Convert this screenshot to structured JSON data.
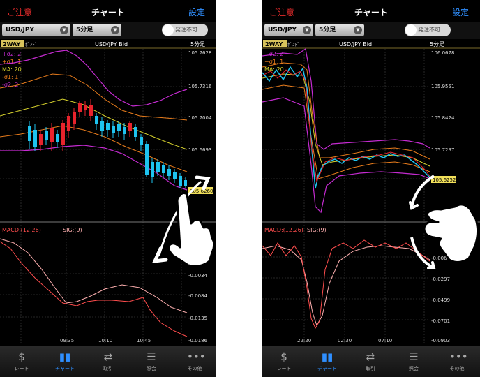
{
  "left": {
    "nav": {
      "back": "ご注意",
      "title": "チャート",
      "settings": "設定"
    },
    "controls": {
      "pair": "USD/JPY",
      "interval": "5分足",
      "order_toggle": "発注不可"
    },
    "chart": {
      "tag": "2WAY",
      "tag_suffix": "ﾎﾞﾝﾄﾞ",
      "header": "USD/JPY  Bid",
      "interval": "5分足",
      "legend": [
        "+σ2: 2",
        "+σ1: 1",
        "MA: 20",
        "-σ1: 1",
        "-σ2: 2"
      ],
      "price_labels": [
        "105.7628",
        "105.7316",
        "105.7004",
        "105.6693"
      ],
      "current_price": "105.6260",
      "macd_label": "MACD:(12,26)",
      "sig_label": "SIG:(9)",
      "macd_labels": [
        "-0.0034",
        "-0.0084",
        "-0.0135",
        "-0.0186"
      ],
      "time_labels": [
        "09:35",
        "10:10",
        "10:45"
      ]
    }
  },
  "right": {
    "nav": {
      "back": "ご注意",
      "title": "チャート",
      "settings": "設定"
    },
    "controls": {
      "pair": "USD/JPY",
      "interval": "5分足",
      "order_toggle": "発注不可"
    },
    "chart": {
      "tag": "2WAY",
      "tag_suffix": "ﾎﾞﾝﾄﾞ",
      "header": "USD/JPY  Bid",
      "interval": "5分足",
      "legend": [
        "+σ2: 2",
        "+σ1: 1",
        "MA: 20"
      ],
      "price_labels": [
        "106.0678",
        "105.9551",
        "105.8424",
        "105.7297"
      ],
      "current_price": "105.6252",
      "macd_label": "MACD:(12,26)",
      "sig_label": "SIG:(9)",
      "macd_labels": [
        "-0.006",
        "-0.0297",
        "-0.0499",
        "-0.0701",
        "-0.0903"
      ],
      "time_labels": [
        "22:20",
        "02:30",
        "07:10"
      ]
    }
  },
  "tabs": [
    {
      "label": "レート",
      "icon": "rate-icon"
    },
    {
      "label": "チャート",
      "icon": "chart-icon"
    },
    {
      "label": "取引",
      "icon": "trade-icon"
    },
    {
      "label": "照会",
      "icon": "inquiry-icon"
    },
    {
      "label": "その他",
      "icon": "more-icon"
    }
  ],
  "colors": {
    "accent_red": "#e32b2b",
    "accent_blue": "#2f8fff",
    "bull": "#e8232c",
    "bear": "#1ec3ef",
    "upper2": "#c52bd1",
    "upper1": "#e87c1c",
    "ma": "#d6d12d",
    "macd": "#ff4d4d",
    "signal": "#ffb0b0"
  }
}
